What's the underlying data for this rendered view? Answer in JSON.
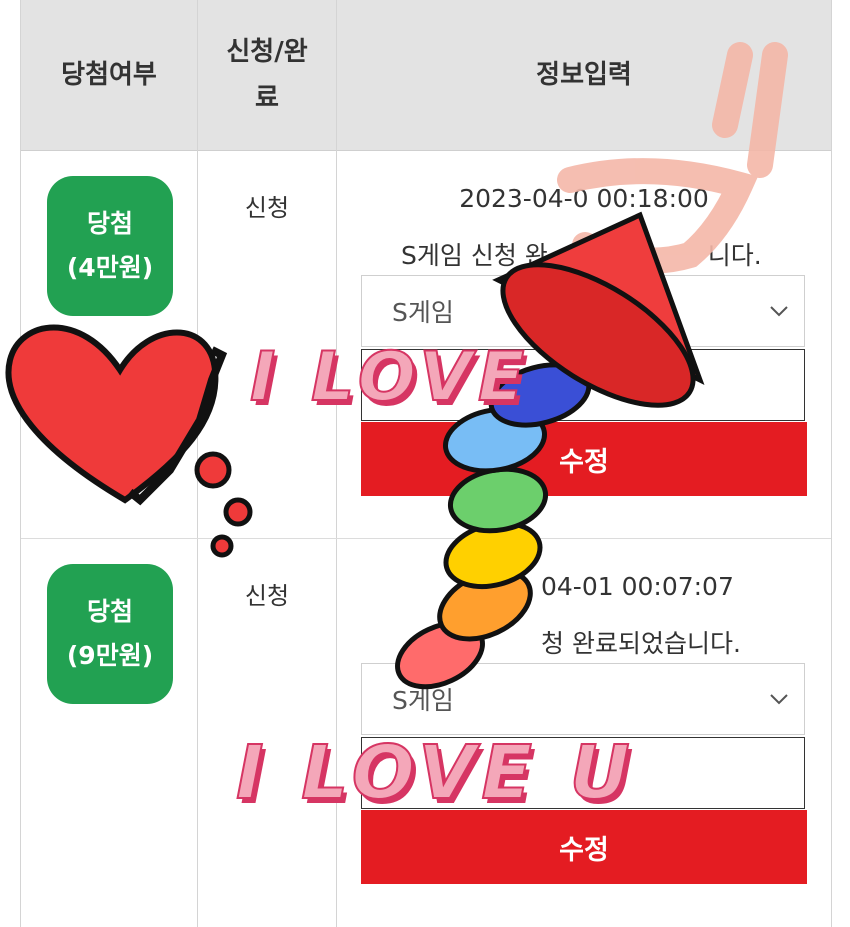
{
  "table": {
    "headers": {
      "result": "당첨여부",
      "apply_done_1": "신청/완",
      "apply_done_2": "료",
      "info_input": "정보입력"
    },
    "rows": [
      {
        "badge_line1": "당첨",
        "badge_line2": "(4만원)",
        "status": "신청",
        "datetime": "2023-04-0 00:18:00",
        "message": "S게임 신청 완",
        "message_tail": "니다.",
        "select_value": "S게임",
        "button_label": "수정"
      },
      {
        "badge_line1": "당첨",
        "badge_line2": "(9만원)",
        "status": "신청",
        "datetime": "04-01 00:07:07",
        "message": "청 완료되었습니다.",
        "select_value": "S게임",
        "button_label": "수정"
      }
    ]
  },
  "stickers": {
    "love1": "I LOVE",
    "love2": "I LOVE U"
  },
  "colors": {
    "header_bg": "#e3e3e3",
    "badge_green": "#22a152",
    "button_red": "#e41c22"
  }
}
